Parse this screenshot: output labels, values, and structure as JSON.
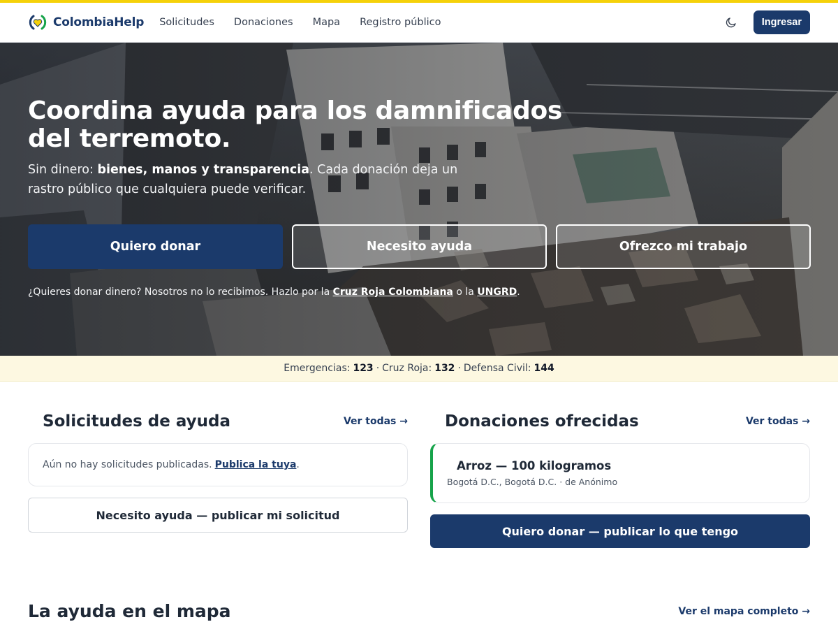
{
  "brand": {
    "name": "ColombiaHelp"
  },
  "nav": {
    "links": [
      "Solicitudes",
      "Donaciones",
      "Mapa",
      "Registro público"
    ],
    "login_label": "Ingresar"
  },
  "hero": {
    "title": "Coordina ayuda para los damnificados del terremoto.",
    "sub_lead": "Sin dinero: ",
    "sub_bold": "bienes, manos y transparencia",
    "sub_rest": ". Cada donación deja un rastro público que cualquiera puede verificar.",
    "cta_donate": "Quiero donar",
    "cta_help": "Necesito ayuda",
    "cta_work": "Ofrezco mi trabajo",
    "note_lead": "¿Quieres donar dinero? Nosotros no lo recibimos. Hazlo por la ",
    "note_link1": "Cruz Roja Colombiana",
    "note_mid": " o la ",
    "note_link2": "UNGRD",
    "note_end": "."
  },
  "emergency": {
    "label1": "Emergencias:",
    "num1": "123",
    "sep": "·",
    "label2": "Cruz Roja:",
    "num2": "132",
    "label3": "Defensa Civil:",
    "num3": "144"
  },
  "requests": {
    "title": "Solicitudes de ayuda",
    "see_all": "Ver todas →",
    "empty_text": "Aún no hay solicitudes publicadas.",
    "empty_link": "Publica la tuya",
    "empty_end": ".",
    "button": "Necesito ayuda — publicar mi solicitud"
  },
  "donations": {
    "title": "Donaciones ofrecidas",
    "see_all": "Ver todas →",
    "item_title": "Arroz — 100 kilogramos",
    "item_meta": "Bogotá D.C., Bogotá D.C. · de Anónimo",
    "button": "Quiero donar — publicar lo que tengo"
  },
  "map": {
    "title": "La ayuda en el mapa",
    "see_all": "Ver el mapa completo →"
  },
  "colors": {
    "primary": "#1b3a6b",
    "accent_yellow": "#f5d10a",
    "success": "#16a34a"
  }
}
